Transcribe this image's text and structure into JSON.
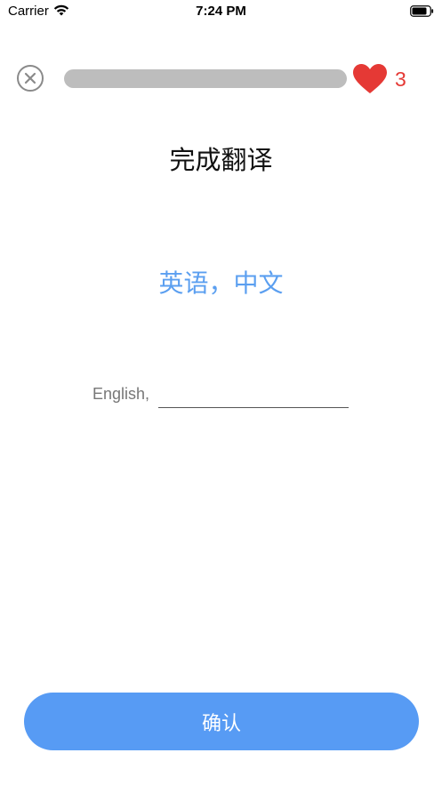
{
  "status_bar": {
    "carrier": "Carrier",
    "time": "7:24 PM",
    "wifi_icon": "wifi-icon",
    "battery_icon": "battery-icon"
  },
  "top_bar": {
    "close_icon": "close-icon",
    "progress_fraction": 0,
    "heart_icon": "heart-icon",
    "hearts_count": "3"
  },
  "exercise": {
    "title": "完成翻译",
    "prompt": "英语，中文",
    "answer_prefix": "English,",
    "answer_value": "",
    "answer_placeholder": ""
  },
  "actions": {
    "confirm_label": "确认"
  },
  "colors": {
    "accent_blue": "#579bf4",
    "prompt_blue": "#5b9ff0",
    "heart_red": "#e53935",
    "progress_track": "#bdbdbd",
    "progress_fill": "#58cc02"
  }
}
